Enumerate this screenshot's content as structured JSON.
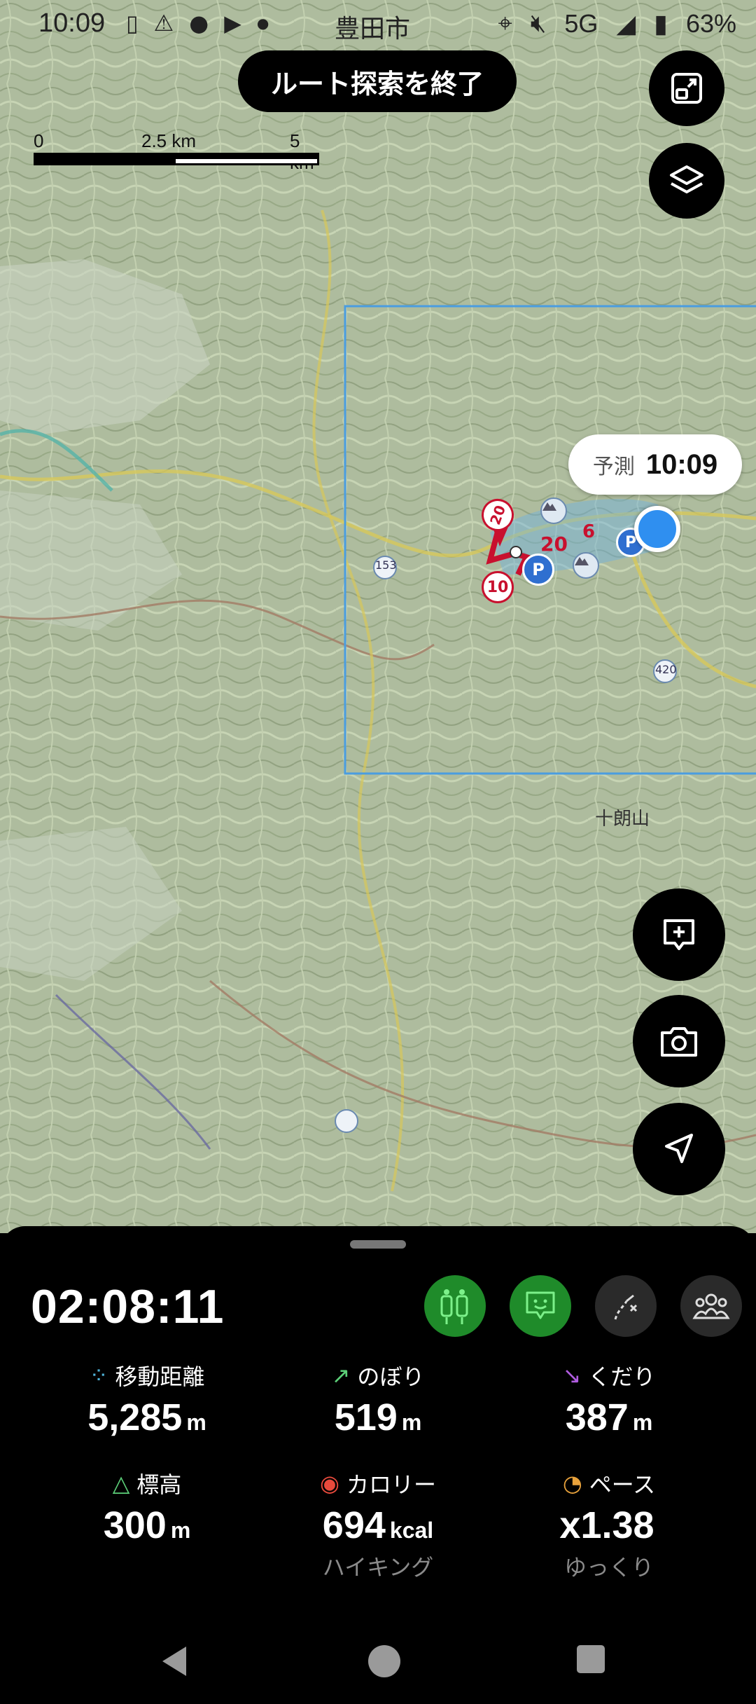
{
  "status_bar": {
    "time": "10:09",
    "city": "豊田市",
    "network": "5G",
    "battery": "63%"
  },
  "map": {
    "end_route_button": "ルート探索を終了",
    "scale": {
      "zero": "0",
      "mid": "2.5 km",
      "max": "5 km"
    },
    "prediction_label": "予測",
    "prediction_time": "10:09",
    "labels": {
      "road_153": "153",
      "road_420": "420",
      "juro": "十朗山",
      "marker_20a": "20",
      "marker_20b": "20",
      "marker_10": "10",
      "marker_6": "6",
      "parking_a": "P",
      "parking_b": "P"
    }
  },
  "panel": {
    "elapsed_time": "02:08:11",
    "stats": {
      "distance": {
        "label": "移動距離",
        "value": "5,285",
        "unit": "m"
      },
      "ascent": {
        "label": "のぼり",
        "value": "519",
        "unit": "m"
      },
      "descent": {
        "label": "くだり",
        "value": "387",
        "unit": "m"
      },
      "elevation": {
        "label": "標高",
        "value": "300",
        "unit": "m"
      },
      "calorie": {
        "label": "カロリー",
        "value": "694",
        "unit": "kcal",
        "sub": "ハイキング"
      },
      "pace": {
        "label": "ペース",
        "value": "x1.38",
        "unit": "",
        "sub": "ゆっくり"
      }
    }
  },
  "icons": {
    "layers": "layers-icon",
    "fullscreen": "fullscreen-icon",
    "memo": "memo-icon",
    "camera": "camera-icon",
    "navigate": "navigate-icon"
  },
  "colors": {
    "accent_green": "#1f8b2a",
    "location_blue": "#2f8ff0",
    "route_red": "#c8102e"
  }
}
